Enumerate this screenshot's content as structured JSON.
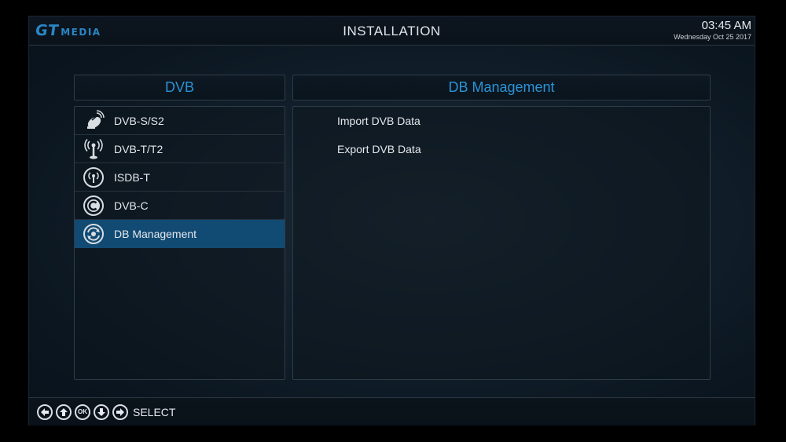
{
  "header": {
    "logo_gt": "GT",
    "logo_media": "MEDIA",
    "title": "INSTALLATION",
    "time": "03:45  AM",
    "date": "Wednesday  Oct 25 2017"
  },
  "left_panel": {
    "title": "DVB",
    "items": [
      {
        "label": "DVB-S/S2",
        "icon": "satellite-dish-icon"
      },
      {
        "label": "DVB-T/T2",
        "icon": "antenna-icon"
      },
      {
        "label": "ISDB-T",
        "icon": "broadcast-icon"
      },
      {
        "label": "DVB-C",
        "icon": "cable-icon"
      },
      {
        "label": "DB Management",
        "icon": "database-refresh-icon",
        "selected": true
      }
    ]
  },
  "right_panel": {
    "title": "DB Management",
    "items": [
      {
        "label": "Import DVB Data"
      },
      {
        "label": "Export DVB Data"
      }
    ]
  },
  "footer": {
    "keys": [
      {
        "icon": "arrow-left-icon"
      },
      {
        "icon": "arrow-up-icon"
      },
      {
        "icon": "ok-icon",
        "text": "OK"
      },
      {
        "icon": "arrow-down-icon"
      },
      {
        "icon": "arrow-right-icon"
      }
    ],
    "action_label": "SELECT"
  },
  "colors": {
    "accent": "#2a93d6",
    "selection": "#114a73",
    "text": "#e4e8ec"
  }
}
